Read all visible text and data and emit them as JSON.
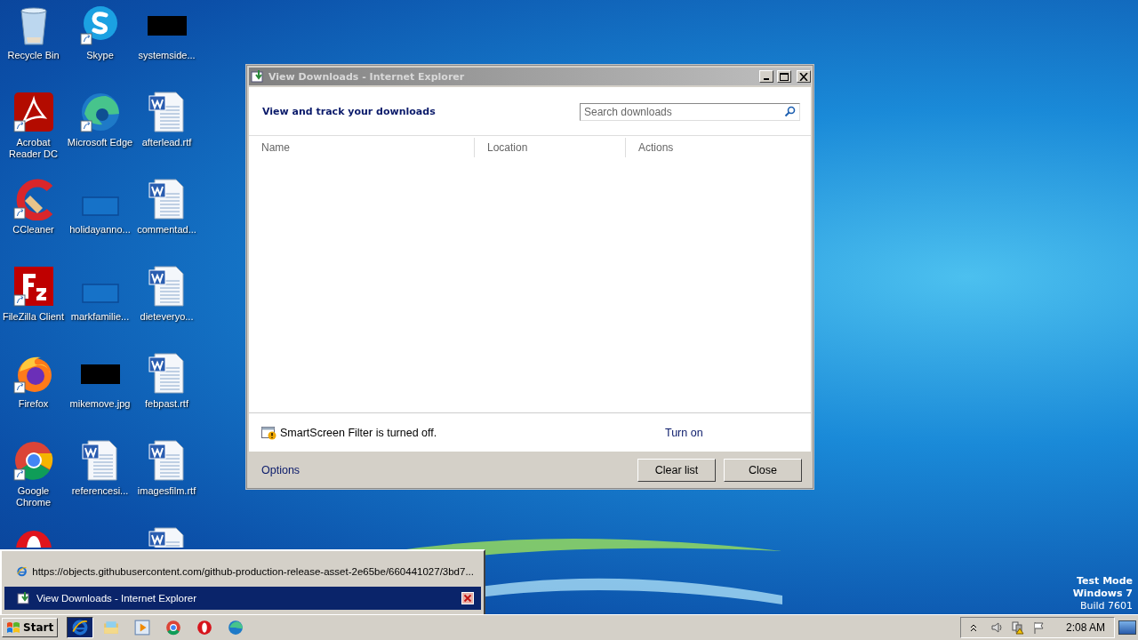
{
  "desktop": {
    "columns": [
      [
        {
          "kind": "recycle",
          "label": "Recycle Bin",
          "shortcut": false
        },
        {
          "kind": "pdf",
          "label": "Acrobat Reader DC",
          "shortcut": true
        },
        {
          "kind": "ccleaner",
          "label": "CCleaner",
          "shortcut": true
        },
        {
          "kind": "filezilla",
          "label": "FileZilla Client",
          "shortcut": true
        },
        {
          "kind": "firefox",
          "label": "Firefox",
          "shortcut": true
        },
        {
          "kind": "chrome",
          "label": "Google Chrome",
          "shortcut": true
        },
        {
          "kind": "opera"
        }
      ],
      [
        {
          "kind": "skype",
          "label": "Skype",
          "shortcut": true
        },
        {
          "kind": "edge",
          "label": "Microsoft Edge",
          "shortcut": true
        },
        {
          "kind": "blank",
          "label": "holidayanno...",
          "shortcut": false
        },
        {
          "kind": "blank",
          "label": "markfamilie...",
          "shortcut": false
        },
        {
          "kind": "redacted",
          "label": "mikemove.jpg",
          "shortcut": false
        },
        {
          "kind": "document",
          "label": "referencesi...",
          "shortcut": false
        }
      ],
      [
        {
          "kind": "redacted",
          "label": "systemside...",
          "shortcut": false
        },
        {
          "kind": "document",
          "label": "afterlead.rtf",
          "shortcut": false
        },
        {
          "kind": "document",
          "label": "commentad...",
          "shortcut": false
        },
        {
          "kind": "document",
          "label": "dieteveryo...",
          "shortcut": false
        },
        {
          "kind": "document",
          "label": "febpast.rtf",
          "shortcut": false
        },
        {
          "kind": "document",
          "label": "imagesfilm.rtf",
          "shortcut": false
        },
        {
          "kind": "document"
        }
      ]
    ],
    "watermark": [
      "Test Mode",
      "Windows 7",
      "Build 7601"
    ]
  },
  "window": {
    "title": "View Downloads - Internet Explorer",
    "heading": "View and track your downloads",
    "search": {
      "placeholder": "Search downloads"
    },
    "table": {
      "columns": [
        "Name",
        "Location",
        "Actions"
      ]
    },
    "smartscreen": {
      "message": "SmartScreen Filter is turned off.",
      "link": "Turn on"
    },
    "footer": {
      "link": "Options",
      "buttons": [
        "Clear list",
        "Close"
      ]
    }
  },
  "taskbar_popup": {
    "items": [
      {
        "kind": "ie",
        "title": "https://objects.githubusercontent.com/github-production-release-asset-2e65be/660441027/3bd7...",
        "selected": false
      },
      {
        "kind": "downloads",
        "title": "View Downloads - Internet Explorer",
        "selected": true
      }
    ]
  },
  "taskbar": {
    "start": "Start",
    "apps": [
      {
        "kind": "ie",
        "selected": true
      },
      {
        "kind": "explorer",
        "selected": false
      },
      {
        "kind": "media",
        "selected": false
      },
      {
        "kind": "chrome",
        "selected": false
      },
      {
        "kind": "opera",
        "selected": false
      },
      {
        "kind": "edge",
        "selected": false
      }
    ],
    "tray": {
      "icons": [
        {
          "kind": "expand"
        },
        {
          "kind": "speaker"
        },
        {
          "kind": "network"
        },
        {
          "kind": "flag"
        }
      ],
      "time": "2:08 AM"
    }
  }
}
